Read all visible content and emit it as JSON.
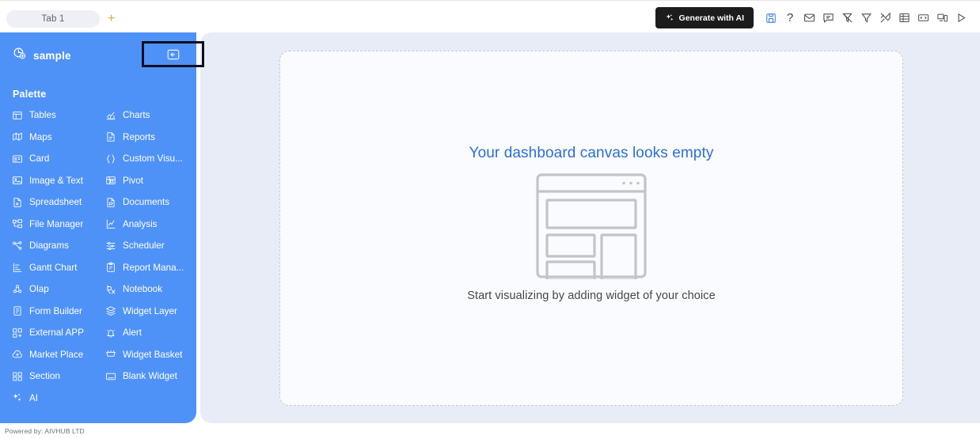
{
  "topbar": {
    "tabs": [
      {
        "label": "Tab 1",
        "active": true
      }
    ],
    "add_tab_label": "+",
    "generate_button": {
      "label": "Generate with AI",
      "icon": "sparkle-icon",
      "bg": "#1c1c1c"
    },
    "tool_icons": [
      {
        "name": "save-icon",
        "title": "Save",
        "color": "#3d7de0"
      },
      {
        "name": "help-icon",
        "title": "Help",
        "color": "#3c3f45"
      },
      {
        "name": "mail-icon",
        "title": "Mail",
        "color": "#4a4f57"
      },
      {
        "name": "comment-icon",
        "title": "Comment",
        "color": "#4a4f57"
      },
      {
        "name": "filter-clear-icon",
        "title": "Clear Filter",
        "color": "#4a4f57"
      },
      {
        "name": "filter-icon",
        "title": "Filter",
        "color": "#4a4f57"
      },
      {
        "name": "tools-icon",
        "title": "Tools",
        "color": "#4a4f57"
      },
      {
        "name": "grid-icon",
        "title": "Grid",
        "color": "#4a4f57"
      },
      {
        "name": "code-icon",
        "title": "Code",
        "color": "#4a4f57"
      },
      {
        "name": "devices-icon",
        "title": "Responsive",
        "color": "#4a4f57"
      },
      {
        "name": "play-icon",
        "title": "Preview",
        "color": "#4a4f57"
      }
    ]
  },
  "sidebar": {
    "title": "sample",
    "title_icon": "dashboard-add-icon",
    "collapse_icon": "collapse-left-icon",
    "palette_label": "Palette",
    "accent_color": "#4f92f7",
    "items": [
      {
        "label": "Tables",
        "icon": "table-icon"
      },
      {
        "label": "Charts",
        "icon": "chart-icon"
      },
      {
        "label": "Maps",
        "icon": "map-icon"
      },
      {
        "label": "Reports",
        "icon": "report-icon"
      },
      {
        "label": "Card",
        "icon": "card-icon"
      },
      {
        "label": "Custom Visu...",
        "icon": "braces-icon"
      },
      {
        "label": "Image & Text",
        "icon": "image-text-icon"
      },
      {
        "label": "Pivot",
        "icon": "pivot-icon"
      },
      {
        "label": "Spreadsheet",
        "icon": "spreadsheet-icon"
      },
      {
        "label": "Documents",
        "icon": "document-icon"
      },
      {
        "label": "File Manager",
        "icon": "file-manager-icon"
      },
      {
        "label": "Analysis",
        "icon": "analysis-icon"
      },
      {
        "label": "Diagrams",
        "icon": "diagram-icon"
      },
      {
        "label": "Scheduler",
        "icon": "scheduler-icon"
      },
      {
        "label": "Gantt Chart",
        "icon": "gantt-icon"
      },
      {
        "label": "Report Mana...",
        "icon": "clipboard-icon"
      },
      {
        "label": "Olap",
        "icon": "olap-icon"
      },
      {
        "label": "Notebook",
        "icon": "notebook-icon"
      },
      {
        "label": "Form Builder",
        "icon": "form-icon"
      },
      {
        "label": "Widget Layer",
        "icon": "layers-icon"
      },
      {
        "label": "External APP",
        "icon": "external-app-icon"
      },
      {
        "label": "Alert",
        "icon": "bell-alert-icon"
      },
      {
        "label": "Market Place",
        "icon": "market-place-icon"
      },
      {
        "label": "Widget Basket",
        "icon": "basket-icon"
      },
      {
        "label": "Section",
        "icon": "section-icon"
      },
      {
        "label": "Blank Widget",
        "icon": "blank-widget-icon"
      },
      {
        "label": "AI",
        "icon": "sparkle-icon",
        "full_width": true
      }
    ],
    "footer": "Powered by: AIVHUB LTD"
  },
  "canvas": {
    "empty_title": "Your dashboard canvas looks empty",
    "empty_subtitle": "Start visualizing by adding widget of your choice",
    "illustration": "dashboard-placeholder-illustration",
    "title_color": "#2a6fd6"
  }
}
